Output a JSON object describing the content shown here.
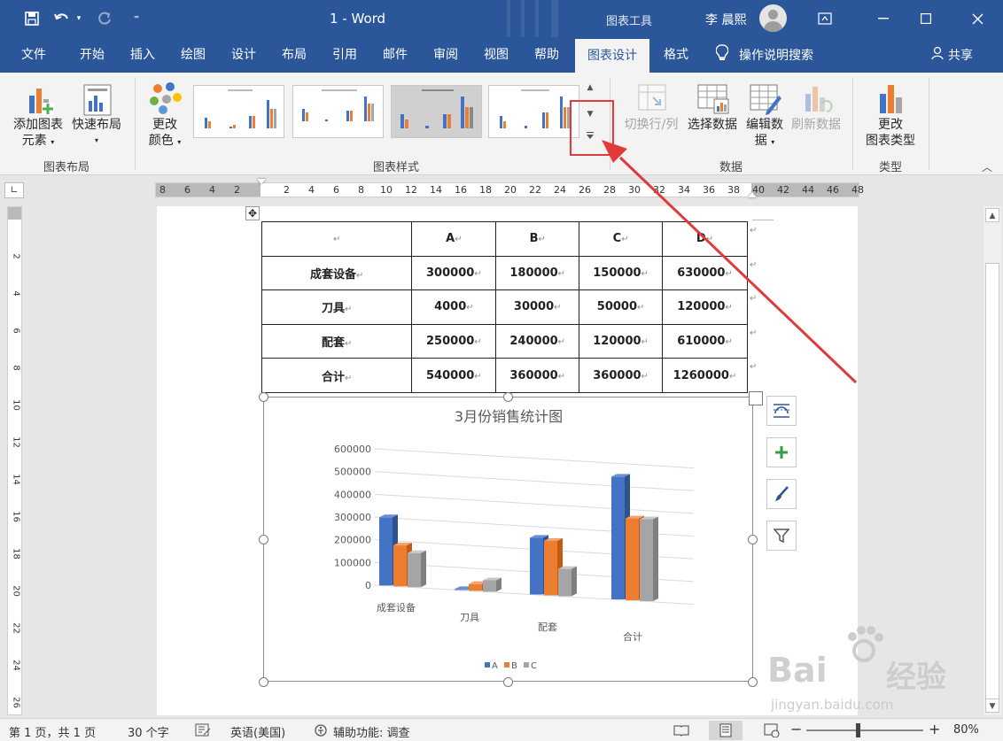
{
  "titlebar": {
    "doc_title": "1  -  Word",
    "tools_label": "图表工具",
    "user_name": "李 晨熙",
    "qa_customize": "⁼"
  },
  "tabs": [
    {
      "label": "文件"
    },
    {
      "label": "开始"
    },
    {
      "label": "插入"
    },
    {
      "label": "绘图"
    },
    {
      "label": "设计"
    },
    {
      "label": "布局"
    },
    {
      "label": "引用"
    },
    {
      "label": "邮件"
    },
    {
      "label": "审阅"
    },
    {
      "label": "视图"
    },
    {
      "label": "帮助"
    },
    {
      "label": "图表设计",
      "active": true
    },
    {
      "label": "格式"
    }
  ],
  "search_label": "操作说明搜索",
  "share_label": "共享",
  "ribbon": {
    "add_element": "添加图表元素",
    "add_element_l1": "添加图表",
    "add_element_l2": "元素",
    "quick_layout": "快速布局",
    "group_layout": "图表布局",
    "change_colors_l1": "更改",
    "change_colors_l2": "颜色",
    "group_styles": "图表样式",
    "switch_row_col": "切换行/列",
    "select_data": "选择数据",
    "edit_data_l1": "编辑数",
    "edit_data_l2": "据",
    "refresh_data": "刷新数据",
    "group_data": "数据",
    "change_type_l1": "更改",
    "change_type_l2": "图表类型",
    "group_type": "类型"
  },
  "ruler": {
    "numbers": [
      "8",
      "6",
      "4",
      "2",
      "",
      "2",
      "4",
      "6",
      "8",
      "10",
      "12",
      "14",
      "16",
      "18",
      "20",
      "22",
      "24",
      "26",
      "28",
      "30",
      "32",
      "34",
      "36",
      "38",
      "40",
      "42",
      "44",
      "46",
      "48"
    ],
    "vertical": [
      "2",
      "4",
      "6",
      "8",
      "10",
      "12",
      "14",
      "16",
      "18",
      "20",
      "22",
      "24",
      "26"
    ]
  },
  "table": {
    "header": [
      "",
      "A",
      "B",
      "C",
      "D"
    ],
    "rows": [
      [
        "成套设备",
        "300000",
        "180000",
        "150000",
        "630000"
      ],
      [
        "刀具",
        "4000",
        "30000",
        "50000",
        "120000"
      ],
      [
        "配套",
        "250000",
        "240000",
        "120000",
        "610000"
      ],
      [
        "合计",
        "540000",
        "360000",
        "360000",
        "1260000"
      ]
    ]
  },
  "chart_data": {
    "type": "bar",
    "title": "3月份销售统计图",
    "categories": [
      "成套设备",
      "刀具",
      "配套",
      "合计"
    ],
    "series": [
      {
        "name": "A",
        "values": [
          300000,
          4000,
          250000,
          540000
        ],
        "color": "#4472c4"
      },
      {
        "name": "B",
        "values": [
          180000,
          30000,
          240000,
          360000
        ],
        "color": "#ed7d31"
      },
      {
        "name": "C",
        "values": [
          150000,
          50000,
          120000,
          360000
        ],
        "color": "#a5a5a5"
      }
    ],
    "y_ticks": [
      "600000",
      "500000",
      "400000",
      "300000",
      "200000",
      "100000",
      "0"
    ],
    "ylim": [
      0,
      600000
    ],
    "legend_position": "bottom",
    "style": "3d-clustered-column"
  },
  "status": {
    "page": "第 1 页，共 1 页",
    "words": "30 个字",
    "language": "英语(美国)",
    "accessibility": "辅助功能: 调查",
    "zoom": "80%"
  },
  "watermark": {
    "line1": "Bai",
    "line2": "经验",
    "line3": "jingyan.baidu.com"
  },
  "colors": {
    "brand": "#2b579a",
    "annotation": "#e03a3a"
  }
}
